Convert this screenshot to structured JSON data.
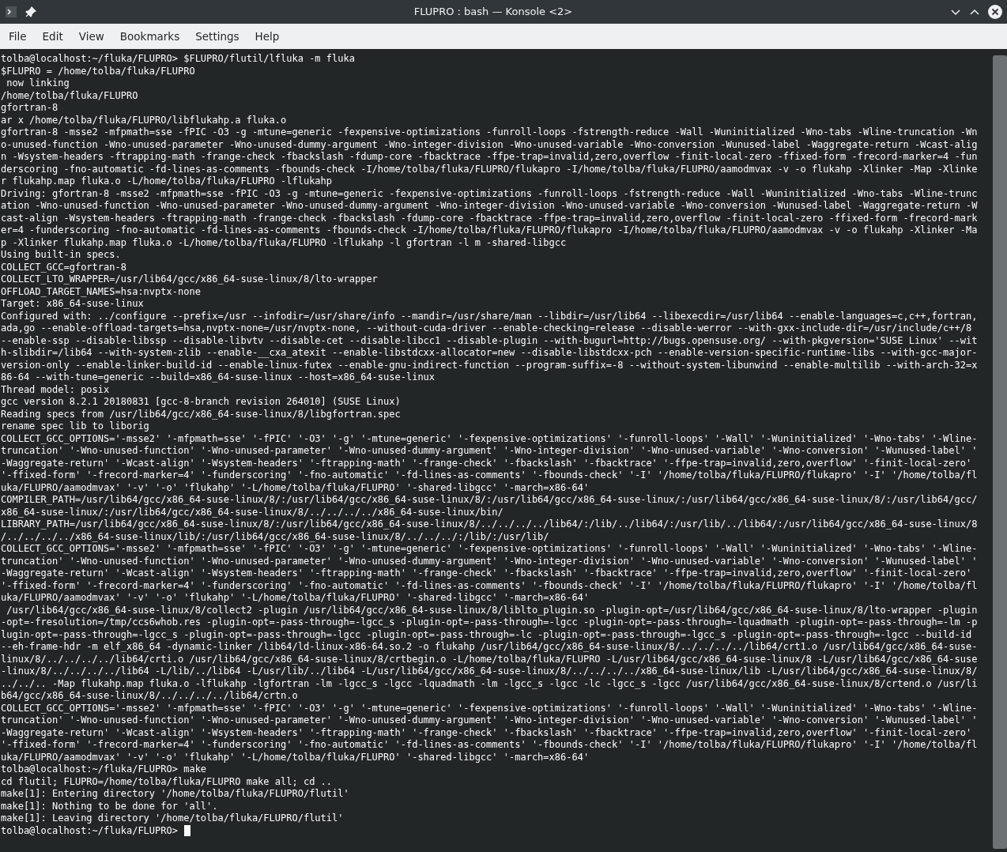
{
  "window": {
    "title": "FLUPRO : bash — Konsole <2>"
  },
  "menu": [
    "File",
    "Edit",
    "View",
    "Bookmarks",
    "Settings",
    "Help"
  ],
  "terminal": {
    "cursor_visible": true,
    "lines": [
      "tolba@localhost:~/fluka/FLUPRO> $FLUPRO/flutil/lfluka -m fluka",
      "$FLUPRO = /home/tolba/fluka/FLUPRO",
      " now linking",
      "/home/tolba/fluka/FLUPRO",
      "gfortran-8",
      "ar x /home/tolba/fluka/FLUPRO/libflukahp.a fluka.o",
      "gfortran-8 -msse2 -mfpmath=sse -fPIC -O3 -g -mtune=generic -fexpensive-optimizations -funroll-loops -fstrength-reduce -Wall -Wuninitialized -Wno-tabs -Wline-truncation -Wn",
      "o-unused-function -Wno-unused-parameter -Wno-unused-dummy-argument -Wno-integer-division -Wno-unused-variable -Wno-conversion -Wunused-label -Waggregate-return -Wcast-alig",
      "n -Wsystem-headers -ftrapping-math -frange-check -fbackslash -fdump-core -fbacktrace -ffpe-trap=invalid,zero,overflow -finit-local-zero -ffixed-form -frecord-marker=4 -fun",
      "derscoring -fno-automatic -fd-lines-as-comments -fbounds-check -I/home/tolba/fluka/FLUPRO/flukapro -I/home/tolba/fluka/FLUPRO/aamodmvax -v -o flukahp -Xlinker -Map -Xlinke",
      "r flukahp.map fluka.o -L/home/tolba/fluka/FLUPRO -lflukahp",
      "Driving: gfortran-8 -msse2 -mfpmath=sse -fPIC -O3 -g -mtune=generic -fexpensive-optimizations -funroll-loops -fstrength-reduce -Wall -Wuninitialized -Wno-tabs -Wline-trunc",
      "ation -Wno-unused-function -Wno-unused-parameter -Wno-unused-dummy-argument -Wno-integer-division -Wno-unused-variable -Wno-conversion -Wunused-label -Waggregate-return -W",
      "cast-align -Wsystem-headers -ftrapping-math -frange-check -fbackslash -fdump-core -fbacktrace -ffpe-trap=invalid,zero,overflow -finit-local-zero -ffixed-form -frecord-mark",
      "er=4 -funderscoring -fno-automatic -fd-lines-as-comments -fbounds-check -I/home/tolba/fluka/FLUPRO/flukapro -I/home/tolba/fluka/FLUPRO/aamodmvax -v -o flukahp -Xlinker -Ma",
      "p -Xlinker flukahp.map fluka.o -L/home/tolba/fluka/FLUPRO -lflukahp -l gfortran -l m -shared-libgcc",
      "Using built-in specs.",
      "COLLECT_GCC=gfortran-8",
      "COLLECT_LTO_WRAPPER=/usr/lib64/gcc/x86_64-suse-linux/8/lto-wrapper",
      "OFFLOAD_TARGET_NAMES=hsa:nvptx-none",
      "Target: x86_64-suse-linux",
      "Configured with: ../configure --prefix=/usr --infodir=/usr/share/info --mandir=/usr/share/man --libdir=/usr/lib64 --libexecdir=/usr/lib64 --enable-languages=c,c++,fortran,",
      "ada,go --enable-offload-targets=hsa,nvptx-none=/usr/nvptx-none, --without-cuda-driver --enable-checking=release --disable-werror --with-gxx-include-dir=/usr/include/c++/8",
      "--enable-ssp --disable-libssp --disable-libvtv --disable-cet --disable-libcc1 --disable-plugin --with-bugurl=http://bugs.opensuse.org/ --with-pkgversion='SUSE Linux' --wit",
      "h-slibdir=/lib64 --with-system-zlib --enable-__cxa_atexit --enable-libstdcxx-allocator=new --disable-libstdcxx-pch --enable-version-specific-runtime-libs --with-gcc-major-",
      "version-only --enable-linker-build-id --enable-linux-futex --enable-gnu-indirect-function --program-suffix=-8 --without-system-libunwind --enable-multilib --with-arch-32=x",
      "86-64 --with-tune=generic --build=x86_64-suse-linux --host=x86_64-suse-linux",
      "Thread model: posix",
      "gcc version 8.2.1 20180831 [gcc-8-branch revision 264010] (SUSE Linux)",
      "Reading specs from /usr/lib64/gcc/x86_64-suse-linux/8/libgfortran.spec",
      "rename spec lib to liborig",
      "COLLECT_GCC_OPTIONS='-msse2' '-mfpmath=sse' '-fPIC' '-O3' '-g' '-mtune=generic' '-fexpensive-optimizations' '-funroll-loops' '-Wall' '-Wuninitialized' '-Wno-tabs' '-Wline-",
      "truncation' '-Wno-unused-function' '-Wno-unused-parameter' '-Wno-unused-dummy-argument' '-Wno-integer-division' '-Wno-unused-variable' '-Wno-conversion' '-Wunused-label' '",
      "-Waggregate-return' '-Wcast-align' '-Wsystem-headers' '-ftrapping-math' '-frange-check' '-fbackslash' '-fbacktrace' '-ffpe-trap=invalid,zero,overflow' '-finit-local-zero'",
      "'-ffixed-form' '-frecord-marker=4' '-funderscoring' '-fno-automatic' '-fd-lines-as-comments' '-fbounds-check' '-I' '/home/tolba/fluka/FLUPRO/flukapro' '-I' '/home/tolba/fl",
      "uka/FLUPRO/aamodmvax' '-v' '-o' 'flukahp' '-L/home/tolba/fluka/FLUPRO' '-shared-libgcc' '-march=x86-64'",
      "COMPILER_PATH=/usr/lib64/gcc/x86_64-suse-linux/8/:/usr/lib64/gcc/x86_64-suse-linux/8/:/usr/lib64/gcc/x86_64-suse-linux/:/usr/lib64/gcc/x86_64-suse-linux/8/:/usr/lib64/gcc/",
      "x86_64-suse-linux/:/usr/lib64/gcc/x86_64-suse-linux/8/../../../../x86_64-suse-linux/bin/",
      "LIBRARY_PATH=/usr/lib64/gcc/x86_64-suse-linux/8/:/usr/lib64/gcc/x86_64-suse-linux/8/../../../../lib64/:/lib/../lib64/:/usr/lib/../lib64/:/usr/lib64/gcc/x86_64-suse-linux/8",
      "/../../../../x86_64-suse-linux/lib/:/usr/lib64/gcc/x86_64-suse-linux/8/../../../:/lib/:/usr/lib/",
      "COLLECT_GCC_OPTIONS='-msse2' '-mfpmath=sse' '-fPIC' '-O3' '-g' '-mtune=generic' '-fexpensive-optimizations' '-funroll-loops' '-Wall' '-Wuninitialized' '-Wno-tabs' '-Wline-",
      "truncation' '-Wno-unused-function' '-Wno-unused-parameter' '-Wno-unused-dummy-argument' '-Wno-integer-division' '-Wno-unused-variable' '-Wno-conversion' '-Wunused-label' '",
      "-Waggregate-return' '-Wcast-align' '-Wsystem-headers' '-ftrapping-math' '-frange-check' '-fbackslash' '-fbacktrace' '-ffpe-trap=invalid,zero,overflow' '-finit-local-zero'",
      "'-ffixed-form' '-frecord-marker=4' '-funderscoring' '-fno-automatic' '-fd-lines-as-comments' '-fbounds-check' '-I' '/home/tolba/fluka/FLUPRO/flukapro' '-I' '/home/tolba/fl",
      "uka/FLUPRO/aamodmvax' '-v' '-o' 'flukahp' '-L/home/tolba/fluka/FLUPRO' '-shared-libgcc' '-march=x86-64'",
      " /usr/lib64/gcc/x86_64-suse-linux/8/collect2 -plugin /usr/lib64/gcc/x86_64-suse-linux/8/liblto_plugin.so -plugin-opt=/usr/lib64/gcc/x86_64-suse-linux/8/lto-wrapper -plugin",
      "-opt=-fresolution=/tmp/ccs6whob.res -plugin-opt=-pass-through=-lgcc_s -plugin-opt=-pass-through=-lgcc -plugin-opt=-pass-through=-lquadmath -plugin-opt=-pass-through=-lm -p",
      "lugin-opt=-pass-through=-lgcc_s -plugin-opt=-pass-through=-lgcc -plugin-opt=-pass-through=-lc -plugin-opt=-pass-through=-lgcc_s -plugin-opt=-pass-through=-lgcc --build-id",
      "--eh-frame-hdr -m elf_x86_64 -dynamic-linker /lib64/ld-linux-x86-64.so.2 -o flukahp /usr/lib64/gcc/x86_64-suse-linux/8/../../../../lib64/crt1.o /usr/lib64/gcc/x86_64-suse-",
      "linux/8/../../../../lib64/crti.o /usr/lib64/gcc/x86_64-suse-linux/8/crtbegin.o -L/home/tolba/fluka/FLUPRO -L/usr/lib64/gcc/x86_64-suse-linux/8 -L/usr/lib64/gcc/x86_64-suse",
      "-linux/8/../../../../lib64 -L/lib/../lib64 -L/usr/lib/../lib64 -L/usr/lib64/gcc/x86_64-suse-linux/8/../../../../x86_64-suse-linux/lib -L/usr/lib64/gcc/x86_64-suse-linux/8/",
      "../../.. -Map flukahp.map fluka.o -lflukahp -lgfortran -lm -lgcc_s -lgcc -lquadmath -lm -lgcc_s -lgcc -lc -lgcc_s -lgcc /usr/lib64/gcc/x86_64-suse-linux/8/crtend.o /usr/li",
      "b64/gcc/x86_64-suse-linux/8/../../../../lib64/crtn.o",
      "COLLECT_GCC_OPTIONS='-msse2' '-mfpmath=sse' '-fPIC' '-O3' '-g' '-mtune=generic' '-fexpensive-optimizations' '-funroll-loops' '-Wall' '-Wuninitialized' '-Wno-tabs' '-Wline-",
      "truncation' '-Wno-unused-function' '-Wno-unused-parameter' '-Wno-unused-dummy-argument' '-Wno-integer-division' '-Wno-unused-variable' '-Wno-conversion' '-Wunused-label' '",
      "-Waggregate-return' '-Wcast-align' '-Wsystem-headers' '-ftrapping-math' '-frange-check' '-fbackslash' '-fbacktrace' '-ffpe-trap=invalid,zero,overflow' '-finit-local-zero'",
      "'-ffixed-form' '-frecord-marker=4' '-funderscoring' '-fno-automatic' '-fd-lines-as-comments' '-fbounds-check' '-I' '/home/tolba/fluka/FLUPRO/flukapro' '-I' '/home/tolba/fl",
      "uka/FLUPRO/aamodmvax' '-v' '-o' 'flukahp' '-L/home/tolba/fluka/FLUPRO' '-shared-libgcc' '-march=x86-64'",
      "tolba@localhost:~/fluka/FLUPRO> make",
      "cd flutil; FLUPRO=/home/tolba/fluka/FLUPRO make all; cd ..",
      "make[1]: Entering directory '/home/tolba/fluka/FLUPRO/flutil'",
      "make[1]: Nothing to be done for 'all'.",
      "make[1]: Leaving directory '/home/tolba/fluka/FLUPRO/flutil'",
      "tolba@localhost:~/fluka/FLUPRO>"
    ]
  }
}
